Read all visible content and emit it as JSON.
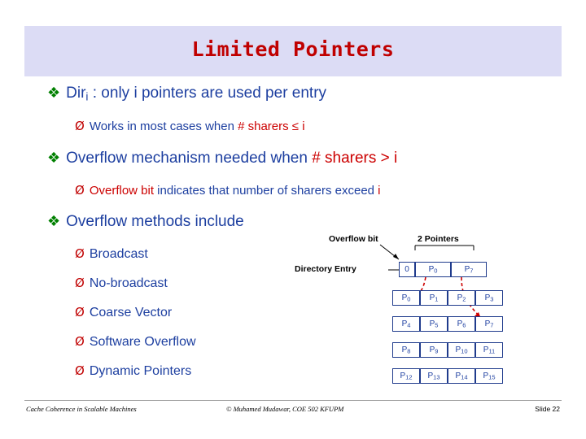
{
  "slide": {
    "title": "Limited Pointers",
    "bullets": [
      {
        "level": 1,
        "mark": "❖",
        "parts": [
          {
            "text": "Dir",
            "color": "blue"
          },
          {
            "text": "i",
            "color": "blue",
            "sub": true
          },
          {
            "text": " : only ",
            "color": "blue"
          },
          {
            "text": "i",
            "color": "blue"
          },
          {
            "text": " pointers are used per entry",
            "color": "blue"
          }
        ],
        "plain": "Diri : only i pointers are used per entry"
      },
      {
        "level": 2,
        "mark": "Ø",
        "plain": "Works in most cases when # sharers ≤ i"
      },
      {
        "level": 1,
        "mark": "❖",
        "plain": "Overflow mechanism needed when # sharers > i"
      },
      {
        "level": 2,
        "mark": "Ø",
        "plain": "Overflow bit indicates that number of sharers exceed i"
      },
      {
        "level": 1,
        "mark": "❖",
        "plain": "Overflow methods include"
      },
      {
        "level": 2,
        "mark": "Ø",
        "plain": "Broadcast"
      },
      {
        "level": 2,
        "mark": "Ø",
        "plain": "No-broadcast"
      },
      {
        "level": 2,
        "mark": "Ø",
        "plain": "Coarse Vector"
      },
      {
        "level": 2,
        "mark": "Ø",
        "plain": "Software Overflow"
      },
      {
        "level": 2,
        "mark": "Ø",
        "plain": "Dynamic Pointers"
      }
    ],
    "bullet_text": {
      "dir_prefix": "Dir",
      "dir_sub": "i",
      "dir_rest_a": " : only ",
      "dir_i": "i",
      "dir_rest_b": " pointers are used per entry",
      "works_pre": "Works in most cases when ",
      "works_red": "# sharers ≤ i",
      "overflow_pre": "Overflow mechanism needed when ",
      "overflow_red": "# sharers > i",
      "overflowbit_red": "Overflow bit",
      "overflowbit_rest_a": " indicates that number of sharers exceed ",
      "overflowbit_i": "i",
      "methods": "Overflow methods include",
      "broadcast": "Broadcast",
      "nobroadcast": "No-broadcast",
      "coarse": "Coarse Vector",
      "software": "Software Overflow",
      "dynamic": "Dynamic Pointers"
    }
  },
  "diagram": {
    "labels": {
      "overflow_bit": "Overflow bit",
      "two_pointers": "2 Pointers",
      "directory_entry": "Directory Entry"
    },
    "entry_row": {
      "overflow_value": "0",
      "pointers": [
        {
          "name": "P",
          "index": "0"
        },
        {
          "name": "P",
          "index": "7"
        }
      ]
    },
    "memory_grid": [
      [
        {
          "name": "P",
          "index": "0"
        },
        {
          "name": "P",
          "index": "1"
        },
        {
          "name": "P",
          "index": "2"
        },
        {
          "name": "P",
          "index": "3"
        }
      ],
      [
        {
          "name": "P",
          "index": "4"
        },
        {
          "name": "P",
          "index": "5"
        },
        {
          "name": "P",
          "index": "6"
        },
        {
          "name": "P",
          "index": "7"
        }
      ],
      [
        {
          "name": "P",
          "index": "8"
        },
        {
          "name": "P",
          "index": "9"
        },
        {
          "name": "P",
          "index": "10"
        },
        {
          "name": "P",
          "index": "11"
        }
      ],
      [
        {
          "name": "P",
          "index": "12"
        },
        {
          "name": "P",
          "index": "13"
        },
        {
          "name": "P",
          "index": "14"
        },
        {
          "name": "P",
          "index": "15"
        }
      ]
    ],
    "colors": {
      "arrow": "#cc0000",
      "cell_border": "#1f3b8c",
      "text": "#1d3fa0"
    }
  },
  "footer": {
    "left": "Cache Coherence in Scalable Machines",
    "center": "© Muhamed Mudawar, COE 502 KFUPM",
    "right": "Slide 22"
  }
}
